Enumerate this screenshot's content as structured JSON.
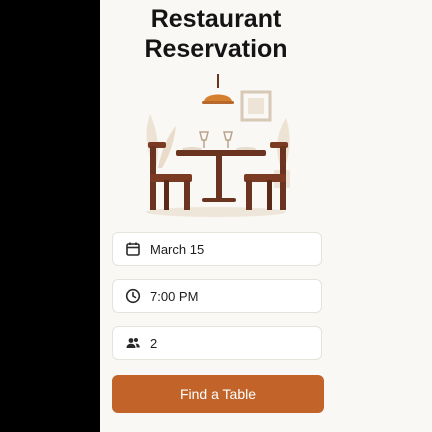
{
  "title_line1": "Restaurant",
  "title_line2": "Reservation",
  "illustration": {
    "subject": "dining-table-with-two-chairs"
  },
  "fields": {
    "date": {
      "icon": "calendar-icon",
      "value": "March 15"
    },
    "time": {
      "icon": "clock-icon",
      "value": "7:00 PM"
    },
    "guests": {
      "icon": "people-icon",
      "value": "2"
    }
  },
  "cta": {
    "label": "Find a Table"
  },
  "colors": {
    "accent": "#c2642a",
    "background": "#faf8f4",
    "furniture": "#6b3420"
  }
}
